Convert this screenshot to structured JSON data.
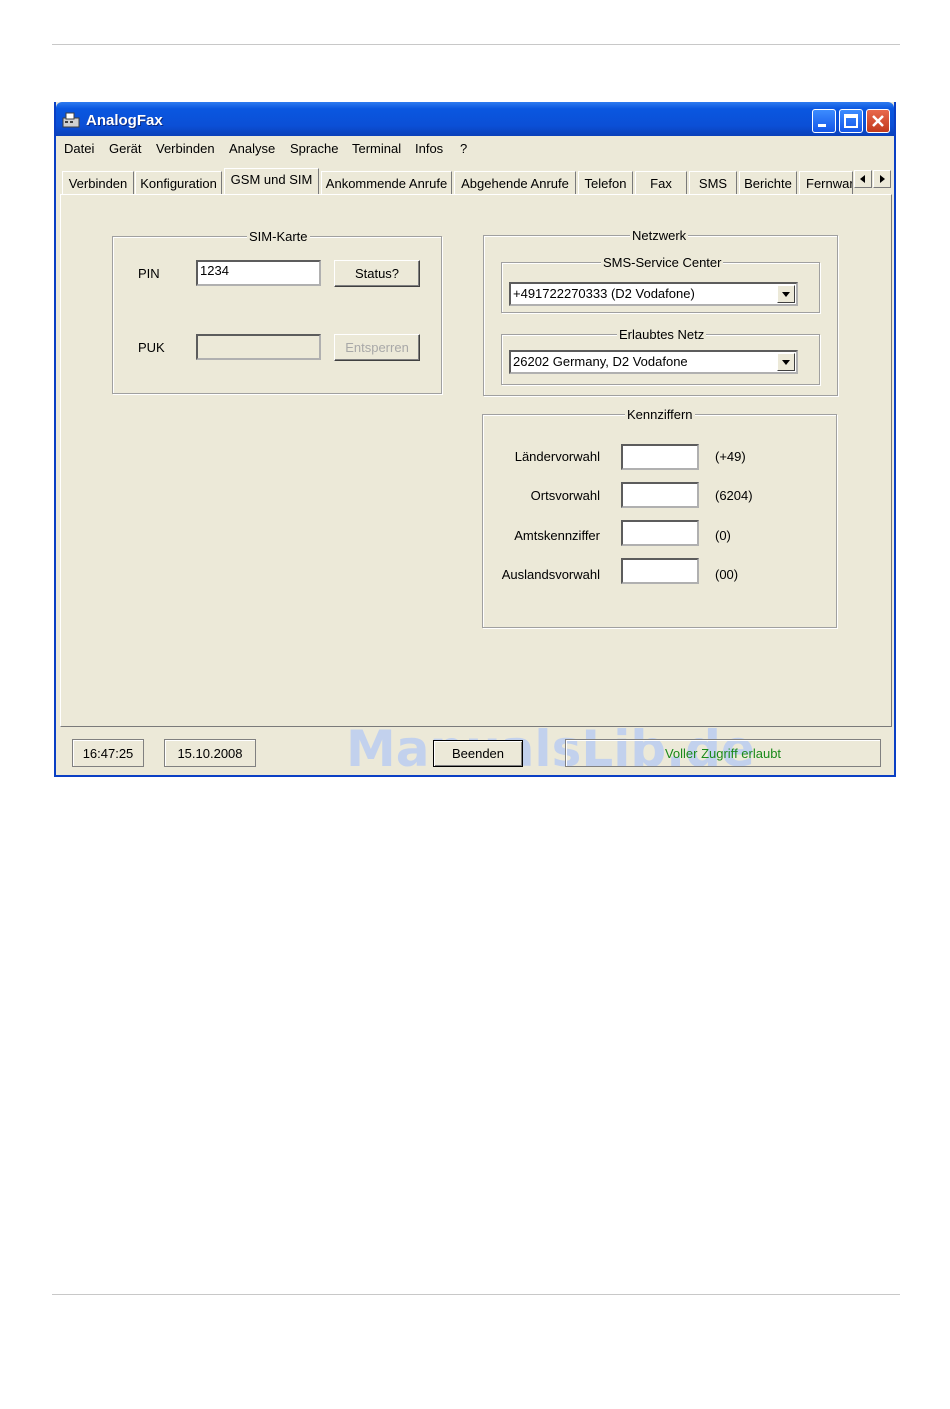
{
  "window": {
    "title": "AnalogFax"
  },
  "menu": [
    "Datei",
    "Gerät",
    "Verbinden",
    "Analyse",
    "Sprache",
    "Terminal",
    "Infos",
    "?"
  ],
  "tabs": [
    "Verbinden",
    "Konfiguration",
    "GSM und SIM",
    "Ankommende Anrufe",
    "Abgehende Anrufe",
    "Telefon",
    "Fax",
    "SMS",
    "Berichte",
    "Fernwar"
  ],
  "active_tab": "GSM und SIM",
  "sim_card": {
    "title": "SIM-Karte",
    "pin_label": "PIN",
    "pin_value": "1234",
    "status_button": "Status?",
    "puk_label": "PUK",
    "puk_value": "",
    "unlock_button": "Entsperren"
  },
  "network": {
    "title": "Netzwerk",
    "sms_center_title": "SMS-Service Center",
    "sms_center_value": "+491722270333 (D2 Vodafone)",
    "allowed_net_title": "Erlaubtes Netz",
    "allowed_net_value": "26202 Germany, D2 Vodafone"
  },
  "codes": {
    "title": "Kennziffern",
    "rows": [
      {
        "label": "Ländervorwahl",
        "value": "",
        "hint": "(+49)"
      },
      {
        "label": "Ortsvorwahl",
        "value": "",
        "hint": "(6204)"
      },
      {
        "label": "Amtskennziffer",
        "value": "",
        "hint": "(0)"
      },
      {
        "label": "Auslandsvorwahl",
        "value": "",
        "hint": "(00)"
      }
    ]
  },
  "status": {
    "time": "16:47:25",
    "date": "15.10.2008",
    "quit_button": "Beenden",
    "access_text": "Voller Zugriff erlaubt",
    "access_color": "#1a8a1a"
  },
  "watermark": "ManualsLib.de",
  "colors": {
    "titlebar": "#0b4fd6",
    "window_bg": "#ece9d8",
    "close_button": "#c23a1c"
  },
  "icons": {
    "app": "fax-machine-icon",
    "minimize": "minimize-icon",
    "maximize": "maximize-icon",
    "close": "close-icon",
    "combo": "chevron-down-icon",
    "scroll_left": "arrow-left-icon",
    "scroll_right": "arrow-right-icon"
  }
}
